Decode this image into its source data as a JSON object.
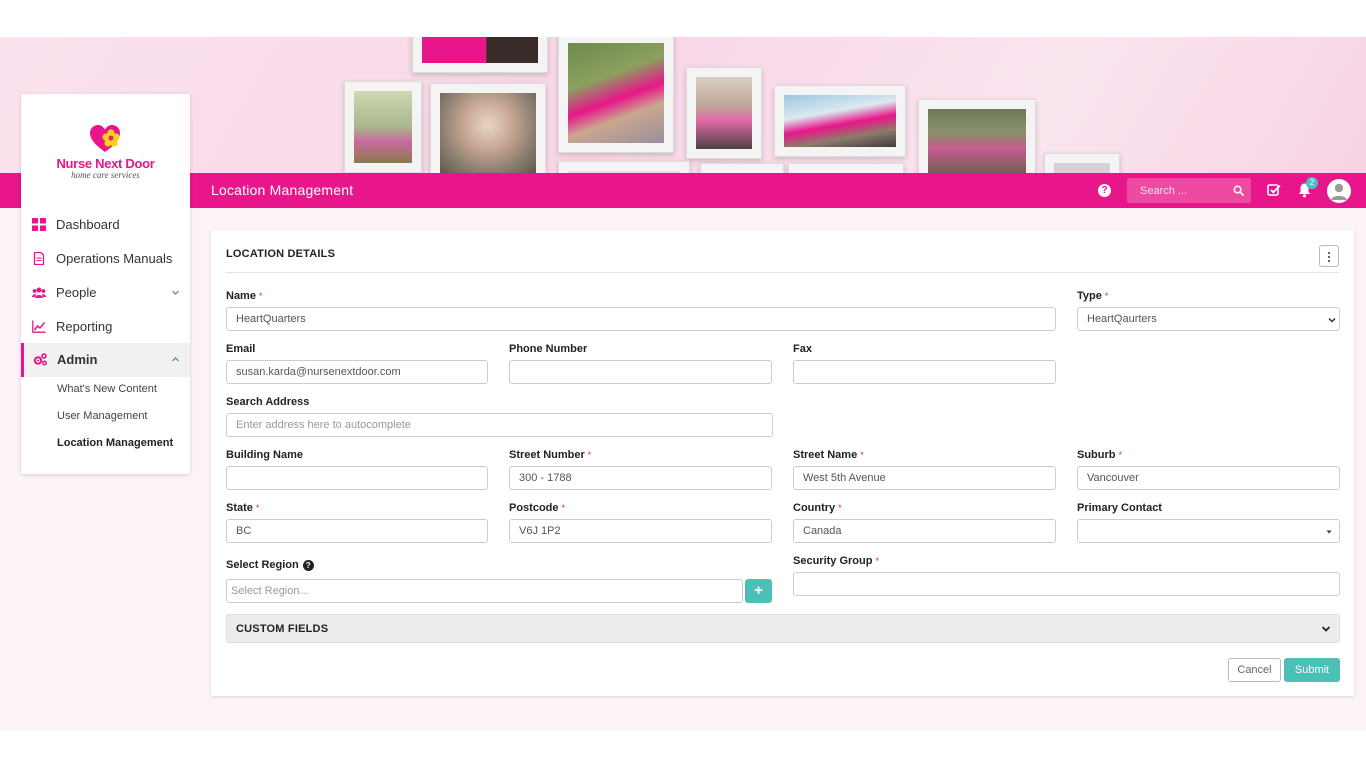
{
  "header": {
    "page_title": "Location Management",
    "search_placeholder": "Search ...",
    "notification_count": "2"
  },
  "brand": {
    "name": "Nurse Next Door",
    "tagline": "home care services",
    "colors": {
      "primary": "#e8168a",
      "accent": "#4ac0b6",
      "logo_yellow": "#f7d117"
    }
  },
  "sidebar": {
    "items": [
      {
        "label": "Dashboard",
        "icon": "dashboard-grid-icon"
      },
      {
        "label": "Operations Manuals",
        "icon": "document-icon"
      },
      {
        "label": "People",
        "icon": "people-icon"
      },
      {
        "label": "Reporting",
        "icon": "chart-line-icon"
      },
      {
        "label": "Admin",
        "icon": "gears-icon"
      }
    ],
    "admin_sub": [
      {
        "label": "What's New Content"
      },
      {
        "label": "User Management"
      },
      {
        "label": "Location Management"
      }
    ]
  },
  "form": {
    "section_title": "LOCATION DETAILS",
    "fields": {
      "name": {
        "label": "Name",
        "value": "HeartQuarters"
      },
      "type": {
        "label": "Type",
        "value": "HeartQaurters"
      },
      "email": {
        "label": "Email",
        "value": "susan.karda@nursenextdoor.com"
      },
      "phone": {
        "label": "Phone Number",
        "value": ""
      },
      "fax": {
        "label": "Fax",
        "value": ""
      },
      "search_address": {
        "label": "Search Address",
        "placeholder": "Enter address here to autocomplete"
      },
      "building_name": {
        "label": "Building Name",
        "value": ""
      },
      "street_number": {
        "label": "Street Number",
        "value": "300 - 1788"
      },
      "street_name": {
        "label": "Street Name",
        "value": "West 5th Avenue"
      },
      "suburb": {
        "label": "Suburb",
        "value": "Vancouver"
      },
      "state": {
        "label": "State",
        "value": "BC"
      },
      "postcode": {
        "label": "Postcode",
        "value": "V6J 1P2"
      },
      "country": {
        "label": "Country",
        "value": "Canada"
      },
      "primary_contact": {
        "label": "Primary Contact",
        "value": ""
      },
      "select_region": {
        "label": "Select Region",
        "placeholder": "Select Region..."
      },
      "security_group": {
        "label": "Security Group",
        "value": ""
      }
    },
    "required_mark": "*",
    "add_symbol": "+",
    "custom_fields_label": "CUSTOM FIELDS",
    "cancel_label": "Cancel",
    "submit_label": "Submit"
  }
}
